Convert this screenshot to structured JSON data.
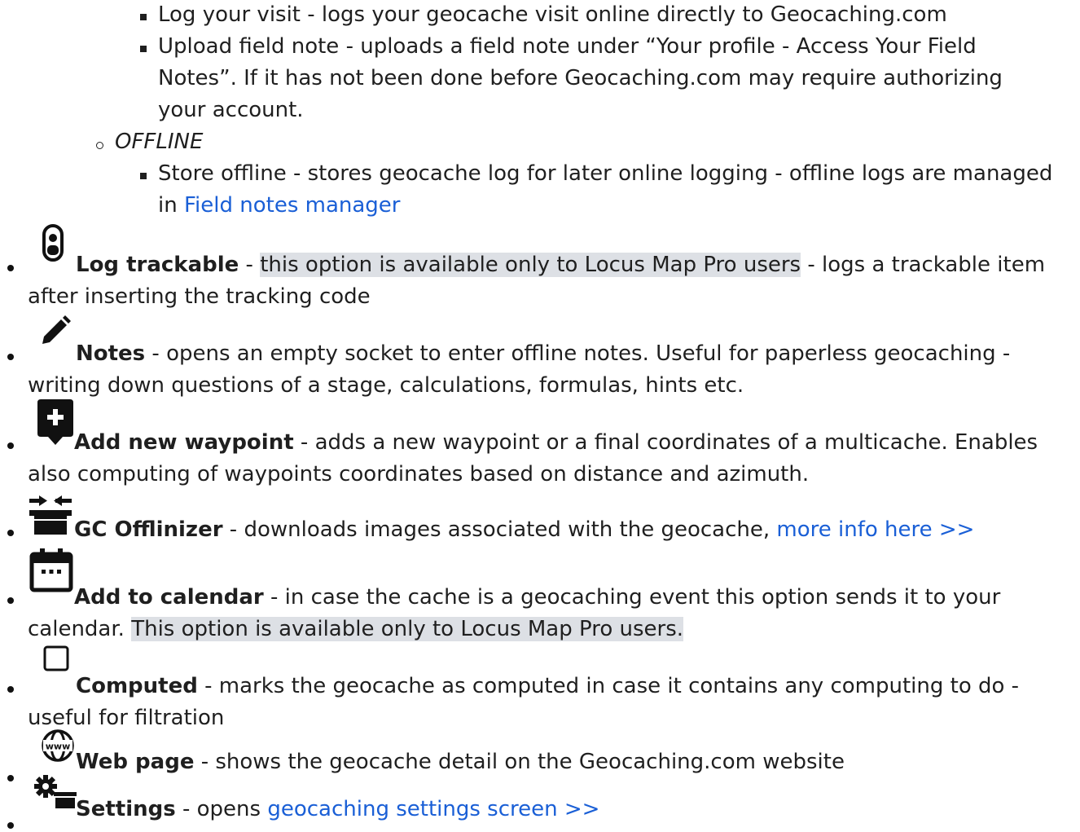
{
  "online_items": [
    "Log your visit - logs your geocache visit online directly to Geocaching.com",
    "Upload field note - uploads a field note under “Your profile - Access Your Field",
    "Notes”. If it has not been done before Geocaching.com may require authorizing",
    "your account."
  ],
  "offline": {
    "heading": "OFFLINE",
    "item_line1": "Store offline - stores geocache log for later online logging - offline logs are managed",
    "item_in": "in ",
    "item_link": "Field notes manager"
  },
  "items": {
    "log_trackable": {
      "title": "Log trackable",
      "sep": " - ",
      "highlight": "this option is available only to Locus Map Pro users",
      "rest": " - logs a trackable item",
      "line2": "after inserting the tracking code"
    },
    "notes": {
      "title": "Notes",
      "rest": " - opens an empty socket to enter offline notes. Useful for paperless geocaching -",
      "line2": "writing down questions of a stage, calculations, formulas, hints etc."
    },
    "add_waypoint": {
      "title": "Add new waypoint",
      "rest": " - adds a new waypoint or a final coordinates of a multicache. Enables",
      "line2": "also computing of waypoints coordinates based on distance and azimuth."
    },
    "gc_offlinizer": {
      "title": "GC Offlinizer",
      "rest": " - downloads images associated with the geocache, ",
      "link": "more info here >>"
    },
    "add_calendar": {
      "title": "Add to calendar",
      "rest": " - in case the cache is a geocaching event this option sends it to your",
      "line2_pre": "calendar. ",
      "line2_highlight": "This option is available only to Locus Map Pro users."
    },
    "computed": {
      "title": "Computed",
      "rest": " - marks the geocache as computed in case it contains any computing to do -",
      "line2": "useful for filtration"
    },
    "web_page": {
      "title": "Web page",
      "rest": " - shows the geocache detail on the Geocaching.com website",
      "icon_text": "www"
    },
    "settings": {
      "title": "Settings",
      "rest": " - opens ",
      "link": "geocaching settings screen >>"
    }
  },
  "icons": [
    "trackable-icon",
    "pencil-icon",
    "add-waypoint-icon",
    "offlinizer-icon",
    "calendar-icon",
    "checkbox-icon",
    "globe-www-icon",
    "settings-icon"
  ],
  "colors": {
    "link": "#1a5fd6",
    "highlight": "#dde0e5",
    "text": "#1f1f1f"
  }
}
